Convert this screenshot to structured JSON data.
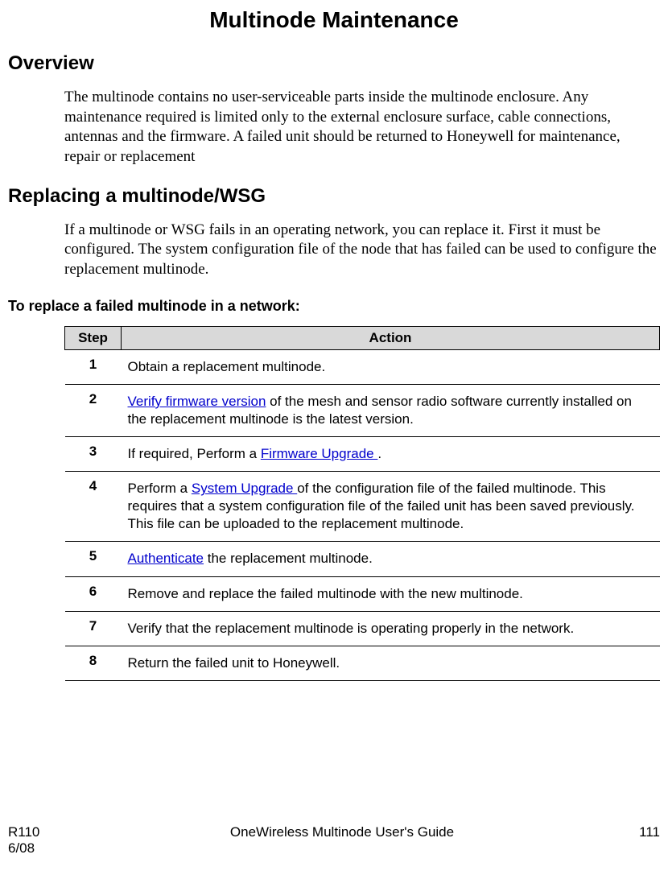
{
  "title": "Multinode Maintenance",
  "overview": {
    "heading": "Overview",
    "para": "The multinode contains no user-serviceable parts inside the multinode enclosure. Any maintenance required is limited only to the external enclosure surface, cable connections, antennas and the firmware. A failed unit should be returned to Honeywell for maintenance, repair or replacement"
  },
  "replacing": {
    "heading": "Replacing a multinode/WSG",
    "para": "If a multinode or WSG fails in an operating network, you can replace it.  First it must be configured.  The system configuration file of the node that has failed can be used to configure the replacement multinode."
  },
  "procedure": {
    "subhead": "To replace a failed multinode in a network:",
    "columns": {
      "step": "Step",
      "action": "Action"
    },
    "rows": [
      {
        "num": "1",
        "pre": "",
        "link": "",
        "post": "Obtain a replacement multinode."
      },
      {
        "num": "2",
        "pre": "",
        "link": "Verify firmware version",
        "post": " of the mesh and sensor radio software currently installed on the replacement multinode is the latest version."
      },
      {
        "num": "3",
        "pre": "If required, Perform a ",
        "link": "Firmware Upgrade ",
        "post": "."
      },
      {
        "num": "4",
        "pre": "Perform a ",
        "link": "System Upgrade ",
        "post": "of the configuration file of the failed multinode.  This requires that a system configuration file of the failed unit has been saved previously.  This file can be uploaded to the replacement multinode."
      },
      {
        "num": "5",
        "pre": "",
        "link": "Authenticate",
        "post": " the replacement multinode."
      },
      {
        "num": "6",
        "pre": "",
        "link": "",
        "post": "Remove and replace the failed multinode with the new multinode."
      },
      {
        "num": "7",
        "pre": "",
        "link": "",
        "post": "Verify that the replacement multinode is operating properly in the network."
      },
      {
        "num": "8",
        "pre": "",
        "link": "",
        "post": "Return the failed unit to Honeywell."
      }
    ]
  },
  "footer": {
    "rev": "R110",
    "date": "6/08",
    "doc": "OneWireless Multinode User's Guide",
    "page": "111"
  }
}
